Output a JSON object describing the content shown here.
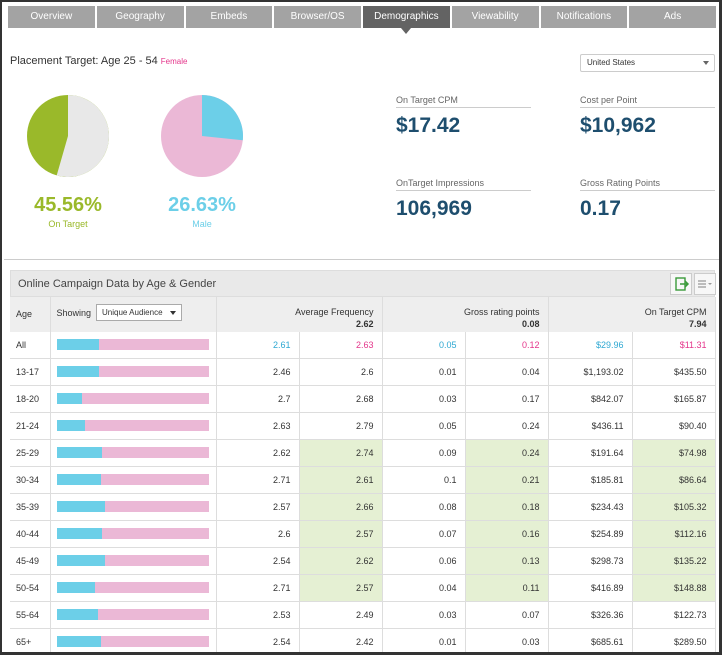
{
  "tabs": [
    "Overview",
    "Geography",
    "Embeds",
    "Browser/OS",
    "Demographics",
    "Viewability",
    "Notifications",
    "Ads"
  ],
  "active_tab": 4,
  "placement": {
    "label": "Placement Target: Age 25 - 54",
    "gender": "Female"
  },
  "country_select": {
    "value": "United States"
  },
  "pies": {
    "on_target": {
      "percent": "45.56%",
      "label": "On Target",
      "value": 45.56,
      "colors": {
        "main": "#9ab92a",
        "rest": "#e8e8e8"
      }
    },
    "male": {
      "percent": "26.63%",
      "label": "Male",
      "value": 26.63,
      "colors": {
        "main": "#6ccfe8",
        "rest": "#ebb8d6"
      }
    }
  },
  "metrics": [
    {
      "label": "On Target CPM",
      "value": "$17.42"
    },
    {
      "label": "Cost per Point",
      "value": "$10,962"
    },
    {
      "label": "OnTarget Impressions",
      "value": "106,969"
    },
    {
      "label": "Gross Rating Points",
      "value": "0.17"
    }
  ],
  "section": {
    "title": "Online Campaign Data by Age & Gender"
  },
  "table": {
    "headers": {
      "age": "Age",
      "showing": "Showing",
      "audience": "Unique Audience",
      "avg_freq": "Average Frequency",
      "avg_freq_total": "2.62",
      "grp": "Gross rating points",
      "grp_total": "0.08",
      "cpm": "On Target CPM",
      "cpm_total": "7.94"
    },
    "rows": [
      {
        "age": "All",
        "male_share": 0.28,
        "freq_m": "2.61",
        "freq_f": "2.63",
        "grp_m": "0.05",
        "grp_f": "0.12",
        "cpm_m": "$29.96",
        "cpm_f": "$11.31",
        "hl": false,
        "colored": true
      },
      {
        "age": "13-17",
        "male_share": 0.28,
        "freq_m": "2.46",
        "freq_f": "2.6",
        "grp_m": "0.01",
        "grp_f": "0.04",
        "cpm_m": "$1,193.02",
        "cpm_f": "$435.50",
        "hl": false
      },
      {
        "age": "18-20",
        "male_share": 0.17,
        "freq_m": "2.7",
        "freq_f": "2.68",
        "grp_m": "0.03",
        "grp_f": "0.17",
        "cpm_m": "$842.07",
        "cpm_f": "$165.87",
        "hl": false
      },
      {
        "age": "21-24",
        "male_share": 0.19,
        "freq_m": "2.63",
        "freq_f": "2.79",
        "grp_m": "0.05",
        "grp_f": "0.24",
        "cpm_m": "$436.11",
        "cpm_f": "$90.40",
        "hl": false
      },
      {
        "age": "25-29",
        "male_share": 0.3,
        "freq_m": "2.62",
        "freq_f": "2.74",
        "grp_m": "0.09",
        "grp_f": "0.24",
        "cpm_m": "$191.64",
        "cpm_f": "$74.98",
        "hl": true
      },
      {
        "age": "30-34",
        "male_share": 0.29,
        "freq_m": "2.71",
        "freq_f": "2.61",
        "grp_m": "0.1",
        "grp_f": "0.21",
        "cpm_m": "$185.81",
        "cpm_f": "$86.64",
        "hl": true
      },
      {
        "age": "35-39",
        "male_share": 0.32,
        "freq_m": "2.57",
        "freq_f": "2.66",
        "grp_m": "0.08",
        "grp_f": "0.18",
        "cpm_m": "$234.43",
        "cpm_f": "$105.32",
        "hl": true
      },
      {
        "age": "40-44",
        "male_share": 0.3,
        "freq_m": "2.6",
        "freq_f": "2.57",
        "grp_m": "0.07",
        "grp_f": "0.16",
        "cpm_m": "$254.89",
        "cpm_f": "$112.16",
        "hl": true
      },
      {
        "age": "45-49",
        "male_share": 0.32,
        "freq_m": "2.54",
        "freq_f": "2.62",
        "grp_m": "0.06",
        "grp_f": "0.13",
        "cpm_m": "$298.73",
        "cpm_f": "$135.22",
        "hl": true
      },
      {
        "age": "50-54",
        "male_share": 0.25,
        "freq_m": "2.71",
        "freq_f": "2.57",
        "grp_m": "0.04",
        "grp_f": "0.11",
        "cpm_m": "$416.89",
        "cpm_f": "$148.88",
        "hl": true
      },
      {
        "age": "55-64",
        "male_share": 0.27,
        "freq_m": "2.53",
        "freq_f": "2.49",
        "grp_m": "0.03",
        "grp_f": "0.07",
        "cpm_m": "$326.36",
        "cpm_f": "$122.73",
        "hl": false
      },
      {
        "age": "65+",
        "male_share": 0.29,
        "freq_m": "2.54",
        "freq_f": "2.42",
        "grp_m": "0.01",
        "grp_f": "0.03",
        "cpm_m": "$685.61",
        "cpm_f": "$289.50",
        "hl": false
      }
    ]
  },
  "icons": {
    "export": "export-icon",
    "list": "list-menu-icon"
  }
}
